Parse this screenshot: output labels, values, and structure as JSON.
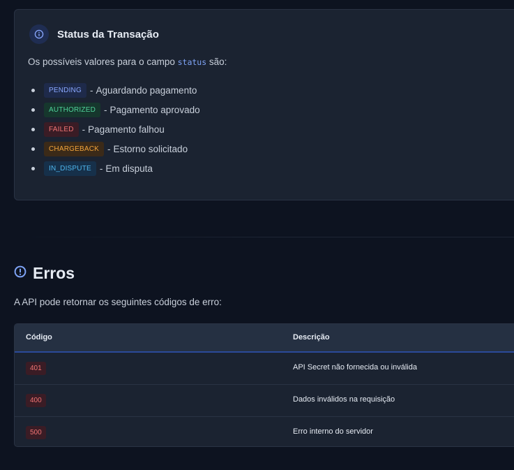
{
  "colors": {
    "background": "#0d1320",
    "card": "#1b2331",
    "accent": "#7ea3f5",
    "error": "#f27474"
  },
  "status_card": {
    "title": "Status da Transação",
    "intro_before": "Os possíveis valores para o campo ",
    "intro_code": "status",
    "intro_after": " são:",
    "items": [
      {
        "code": "PENDING",
        "separator": "-",
        "description": "Aguardando pagamento",
        "badge_bg": "#1e2a4a",
        "badge_fg": "#8aa8ff"
      },
      {
        "code": "AUTHORIZED",
        "separator": "-",
        "description": "Pagamento aprovado",
        "badge_bg": "#16372d",
        "badge_fg": "#4fd39a"
      },
      {
        "code": "FAILED",
        "separator": "-",
        "description": "Pagamento falhou",
        "badge_bg": "#3a1c25",
        "badge_fg": "#f27474"
      },
      {
        "code": "CHARGEBACK",
        "separator": "-",
        "description": "Estorno solicitado",
        "badge_bg": "#3b2a18",
        "badge_fg": "#f2a43a"
      },
      {
        "code": "IN_DISPUTE",
        "separator": "-",
        "description": "Em disputa",
        "badge_bg": "#16304a",
        "badge_fg": "#4fb8ef"
      }
    ]
  },
  "errors": {
    "title": "Erros",
    "intro": "A API pode retornar os seguintes códigos de erro:",
    "columns": {
      "code": "Código",
      "description": "Descrição"
    },
    "rows": [
      {
        "code": "401",
        "description": "API Secret não fornecida ou inválida"
      },
      {
        "code": "400",
        "description": "Dados inválidos na requisição"
      },
      {
        "code": "500",
        "description": "Erro interno do servidor"
      }
    ]
  }
}
